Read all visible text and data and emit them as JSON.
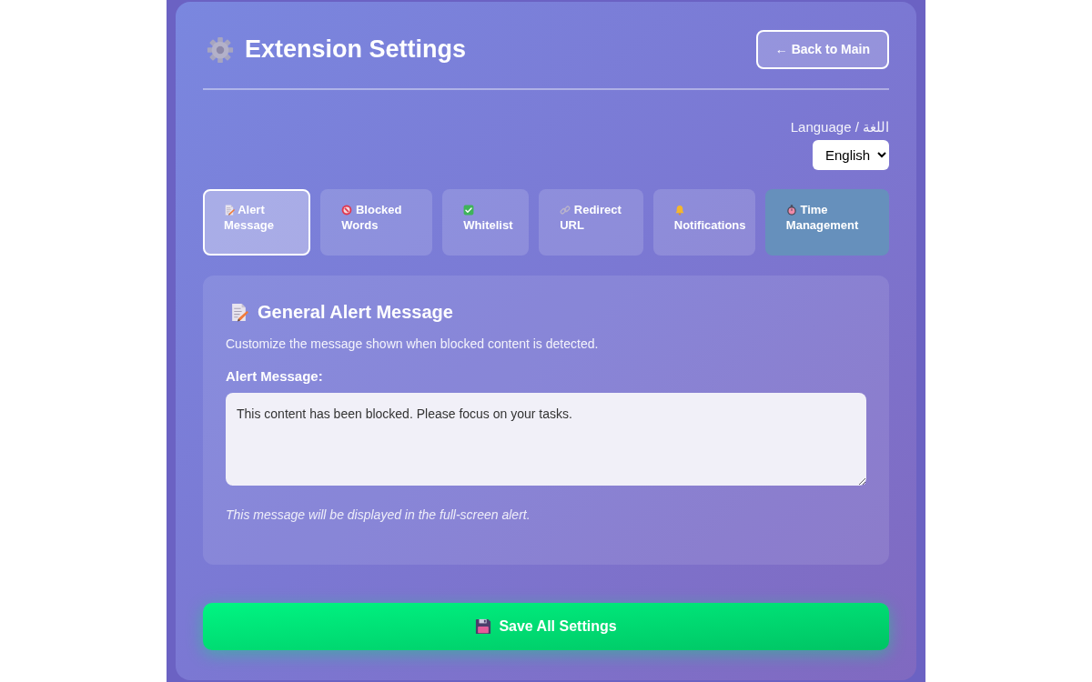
{
  "header": {
    "title": "Extension Settings",
    "back_button": "← Back to Main"
  },
  "language": {
    "label": "Language / اللغة",
    "value": "English"
  },
  "tabs": [
    {
      "label": "Alert Message",
      "selected": true,
      "highlighted": false
    },
    {
      "label": "Blocked Words",
      "selected": false,
      "highlighted": false
    },
    {
      "label": "Whitelist",
      "selected": false,
      "highlighted": false
    },
    {
      "label": "Redirect URL",
      "selected": false,
      "highlighted": false
    },
    {
      "label": "Notifications",
      "selected": false,
      "highlighted": false
    },
    {
      "label": "Time Management",
      "selected": false,
      "highlighted": true
    }
  ],
  "section": {
    "title": "General Alert Message",
    "description": "Customize the message shown when blocked content is detected.",
    "field_label": "Alert Message:",
    "value": "This content has been blocked. Please focus on your tasks.",
    "hint": "This message will be displayed in the full-screen alert."
  },
  "save_button": "Save All Settings"
}
